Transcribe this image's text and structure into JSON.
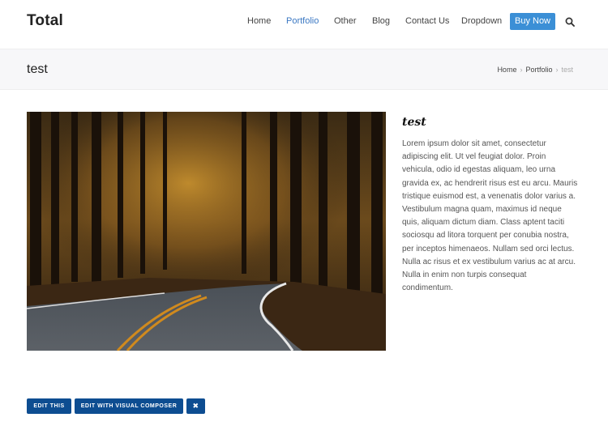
{
  "header": {
    "logo": "Total",
    "nav": [
      "Home",
      "Portfolio",
      "Other",
      "Blog",
      "Contact Us",
      "Dropdown"
    ],
    "active_nav": "Portfolio",
    "buy_label": "Buy Now",
    "search_icon": "search-icon"
  },
  "title_bar": {
    "title": "test",
    "breadcrumb": {
      "home": "Home",
      "section": "Portfolio",
      "current": "test"
    }
  },
  "content": {
    "image_alt": "forest-road-image",
    "heading": "test",
    "body": "Lorem ipsum dolor sit amet, consectetur adipiscing elit. Ut vel feugiat dolor. Proin vehicula, odio id egestas aliquam, leo urna gravida ex, ac hendrerit risus est eu arcu. Mauris tristique euismod est, a venenatis dolor varius a. Vestibulum magna quam, maximus id neque quis, aliquam dictum diam. Class aptent taciti sociosqu ad litora torquent per conubia nostra, per inceptos himenaeos. Nullam sed orci lectus. Nulla ac risus et ex vestibulum varius ac at arcu. Nulla in enim non turpis consequat condimentum."
  },
  "admin": {
    "edit_this": "EDIT THIS",
    "edit_vc": "EDIT WITH VISUAL COMPOSER",
    "close": "✖"
  },
  "colors": {
    "accent": "#3b78c3",
    "buy_button": "#3b8fd6",
    "admin_button": "#0d4d91"
  }
}
